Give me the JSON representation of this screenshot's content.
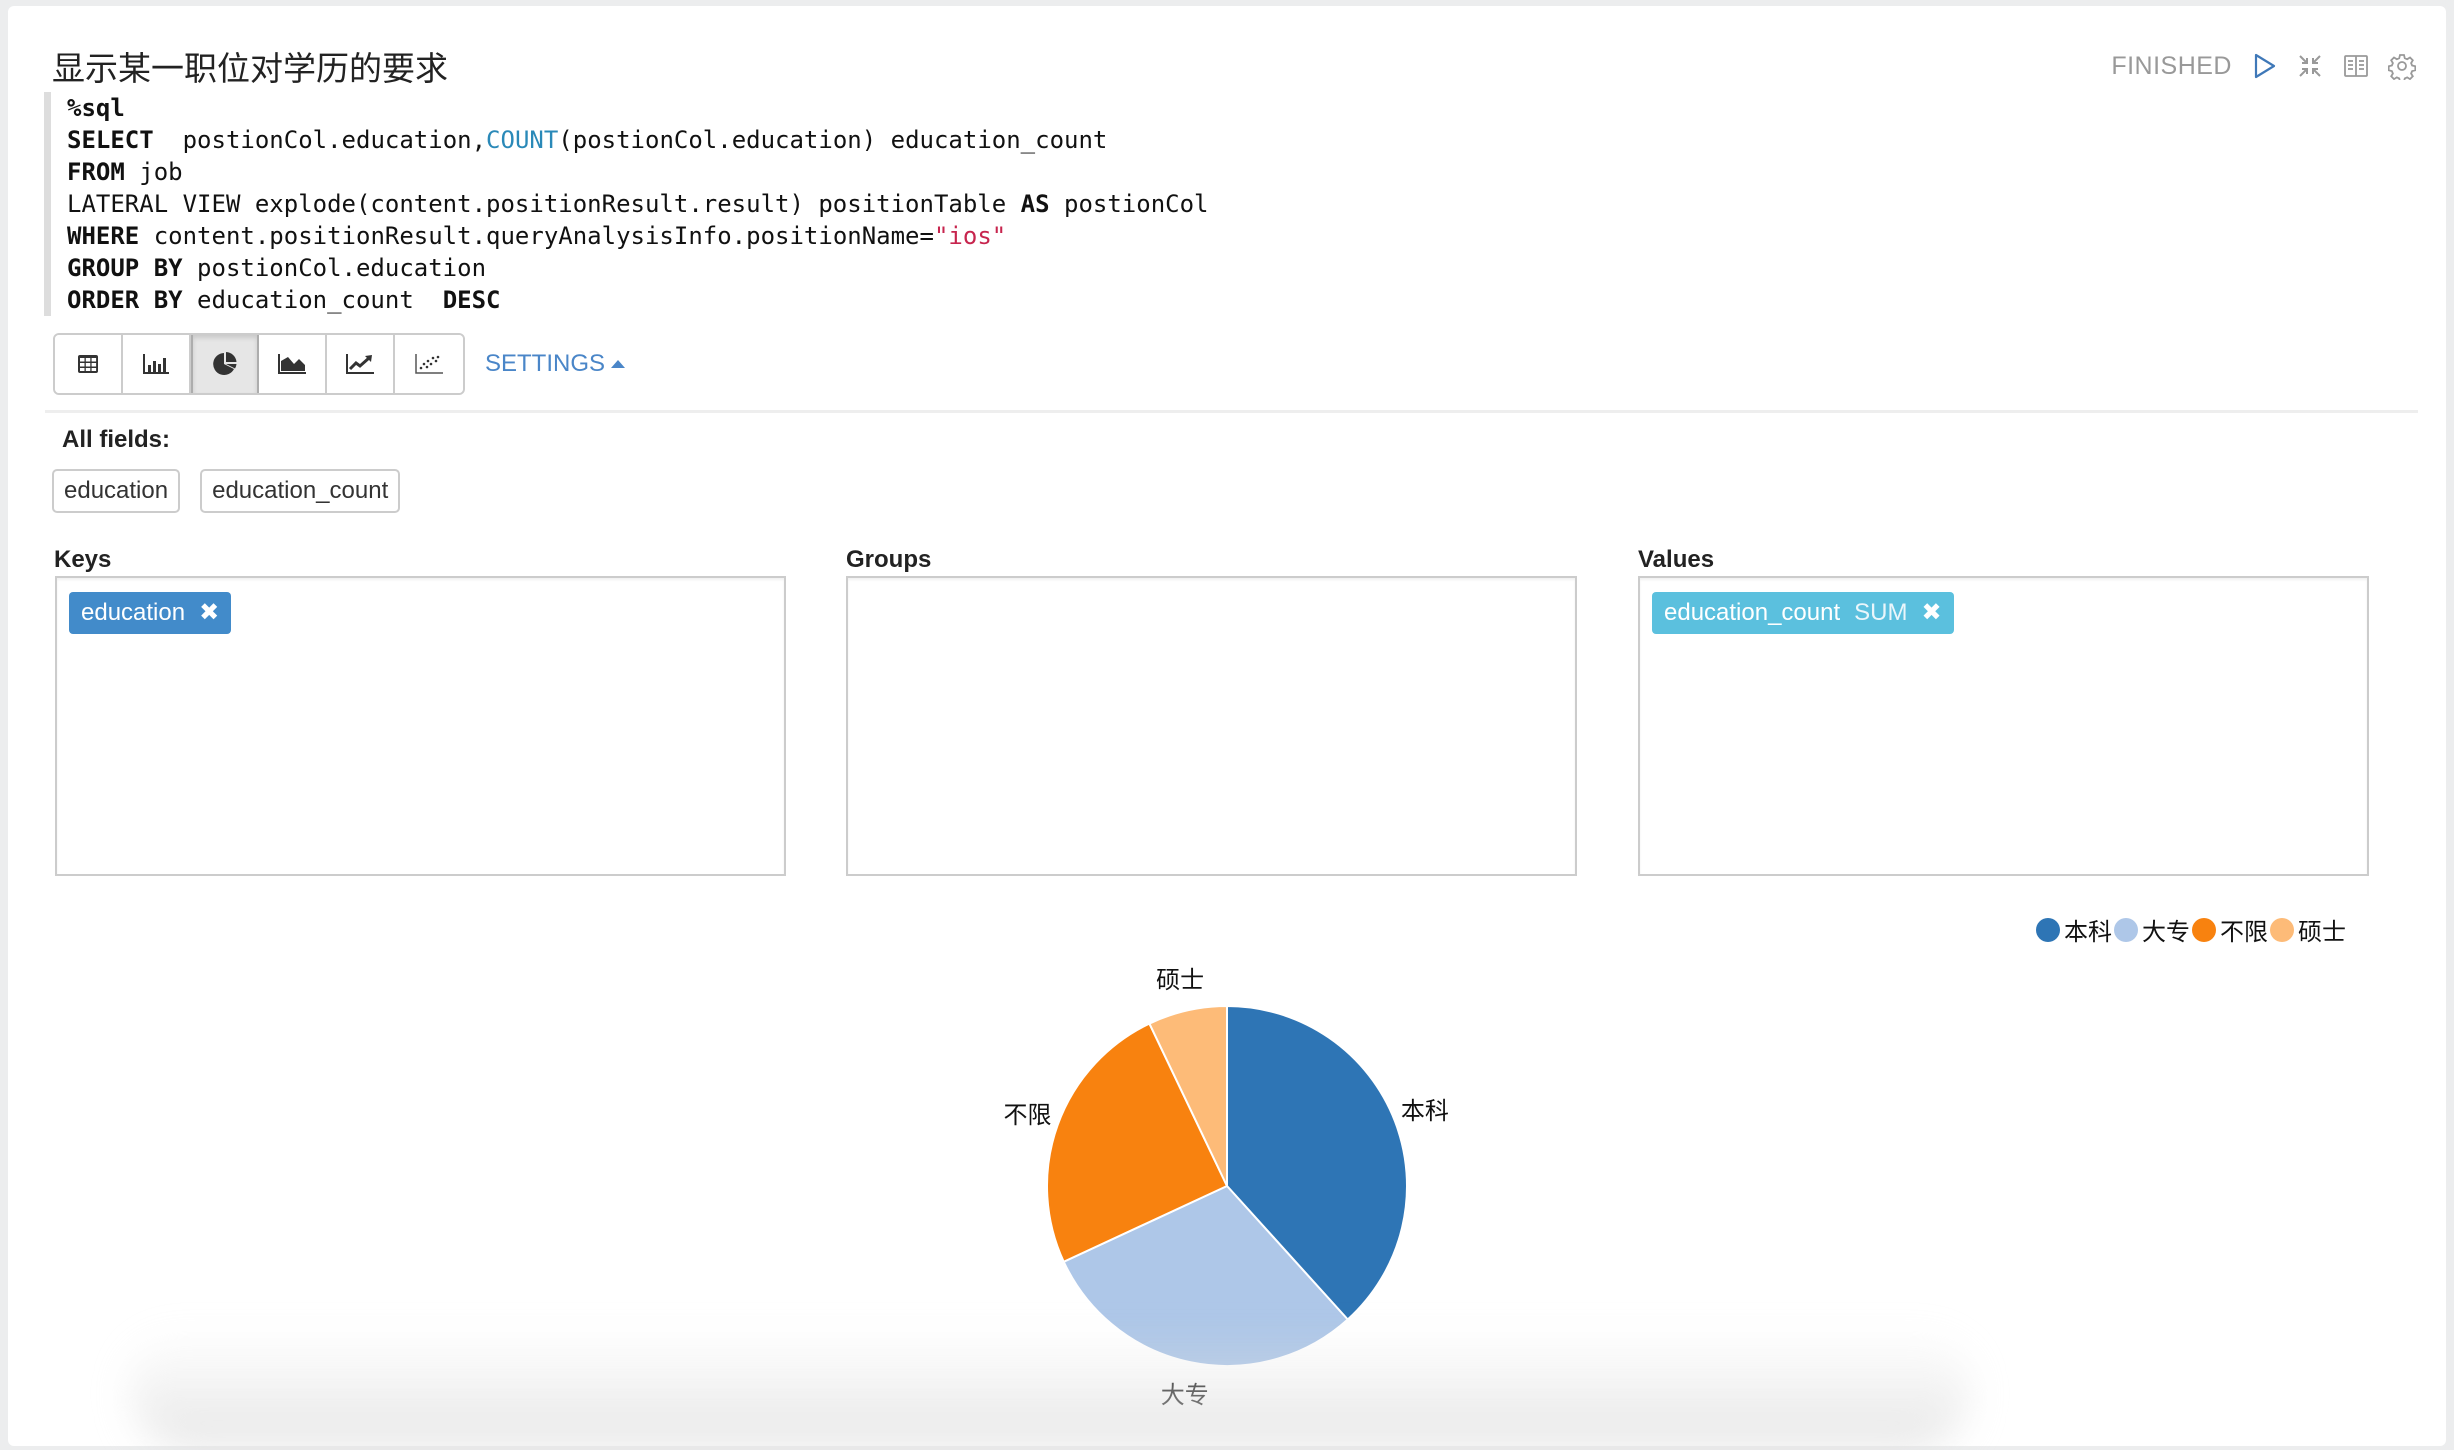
{
  "paragraph": {
    "title": "显示某一职位对学历的要求",
    "status": "FINISHED",
    "controls": [
      {
        "name": "run-icon",
        "label": "Run"
      },
      {
        "name": "collapse-icon",
        "label": "Hide editor"
      },
      {
        "name": "book-icon",
        "label": "Show output"
      },
      {
        "name": "gear-icon",
        "label": "Settings"
      }
    ]
  },
  "code": {
    "lines": [
      [
        {
          "t": "%sql",
          "c": "kw"
        }
      ],
      [
        {
          "t": "SELECT",
          "c": "kw"
        },
        {
          "t": "  postionCol.education,",
          "c": ""
        },
        {
          "t": "COUNT",
          "c": "fn"
        },
        {
          "t": "(postionCol.education) education_count",
          "c": ""
        }
      ],
      [
        {
          "t": "FROM",
          "c": "kw"
        },
        {
          "t": " job",
          "c": ""
        }
      ],
      [
        {
          "t": "LATERAL VIEW explode(content.positionResult.result) positionTable ",
          "c": ""
        },
        {
          "t": "AS",
          "c": "kw"
        },
        {
          "t": " postionCol",
          "c": ""
        }
      ],
      [
        {
          "t": "WHERE",
          "c": "kw"
        },
        {
          "t": " content.positionResult.queryAnalysisInfo.positionName=",
          "c": ""
        },
        {
          "t": "\"ios\"",
          "c": "str"
        }
      ],
      [
        {
          "t": "GROUP BY",
          "c": "kw"
        },
        {
          "t": " postionCol.education",
          "c": ""
        }
      ],
      [
        {
          "t": "ORDER BY",
          "c": "kw"
        },
        {
          "t": " education_count  ",
          "c": ""
        },
        {
          "t": "DESC",
          "c": "kw"
        }
      ]
    ]
  },
  "toolbar": {
    "views": [
      {
        "name": "table-view-button",
        "icon": "table-icon",
        "active": false
      },
      {
        "name": "bar-chart-view-button",
        "icon": "bar-chart-icon",
        "active": false
      },
      {
        "name": "pie-chart-view-button",
        "icon": "pie-chart-icon",
        "active": true
      },
      {
        "name": "area-chart-view-button",
        "icon": "area-chart-icon",
        "active": false
      },
      {
        "name": "line-chart-view-button",
        "icon": "line-chart-icon",
        "active": false
      },
      {
        "name": "scatter-chart-view-button",
        "icon": "scatter-chart-icon",
        "active": false
      }
    ],
    "settings_label": "SETTINGS"
  },
  "settings": {
    "all_fields_label": "All fields:",
    "fields": [
      "education",
      "education_count"
    ],
    "keys_label": "Keys",
    "groups_label": "Groups",
    "values_label": "Values",
    "keys": [
      {
        "label": "education"
      }
    ],
    "groups": [],
    "values": [
      {
        "label": "education_count",
        "agg": "SUM"
      }
    ],
    "colors": {
      "key_tag": "#428bca",
      "value_tag": "#5bc0de"
    }
  },
  "chart_data": {
    "type": "pie",
    "title": "",
    "categories": [
      "本科",
      "大专",
      "不限",
      "硕士"
    ],
    "values": [
      54,
      42,
      35,
      10
    ],
    "percent_estimate": [
      38.4,
      29.7,
      24.8,
      7.1
    ],
    "colors": [
      "#2e75b5",
      "#aec7e8",
      "#f8820f",
      "#fdbb78"
    ],
    "legend": {
      "position": "top-right",
      "entries": [
        "本科",
        "大专",
        "不限",
        "硕士"
      ]
    }
  }
}
